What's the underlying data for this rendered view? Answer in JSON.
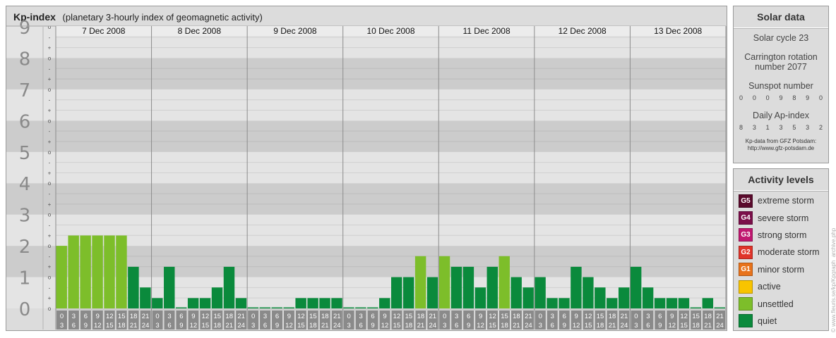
{
  "header": {
    "title": "Kp-index",
    "subtitle": "(planetary 3-hourly index of geomagnetic activity)"
  },
  "chart_data": {
    "type": "bar",
    "ylim": [
      0,
      9
    ],
    "y_ticks": [
      "0",
      "1",
      "2",
      "3",
      "4",
      "5",
      "6",
      "7",
      "8",
      "9"
    ],
    "minor_ticks": [
      "o",
      "+",
      "-"
    ],
    "days": [
      "7 Dec 2008",
      "8 Dec 2008",
      "9 Dec 2008",
      "10 Dec 2008",
      "11 Dec 2008",
      "12 Dec 2008",
      "13 Dec 2008"
    ],
    "interval_start": [
      "0",
      "3",
      "6",
      "9",
      "12",
      "15",
      "18",
      "21"
    ],
    "interval_end": [
      "3",
      "6",
      "9",
      "12",
      "15",
      "18",
      "21",
      "24"
    ],
    "values": [
      [
        2.0,
        2.33,
        2.33,
        2.33,
        2.33,
        2.33,
        1.33,
        0.67
      ],
      [
        0.33,
        1.33,
        0.0,
        0.33,
        0.33,
        0.67,
        1.33,
        0.33
      ],
      [
        0.0,
        0.0,
        0.0,
        0.0,
        0.33,
        0.33,
        0.33,
        0.33
      ],
      [
        0.0,
        0.0,
        0.0,
        0.33,
        1.0,
        1.0,
        1.67,
        1.0
      ],
      [
        1.67,
        1.33,
        1.33,
        0.67,
        1.33,
        1.67,
        1.0,
        0.67
      ],
      [
        1.0,
        0.33,
        0.33,
        1.33,
        1.0,
        0.67,
        0.33,
        0.67
      ],
      [
        1.33,
        0.67,
        0.33,
        0.33,
        0.33,
        0.0,
        0.33,
        0.0
      ]
    ],
    "colors": {
      "quiet": "#0a8a3c",
      "unsettled": "#7dbe2a"
    },
    "legend_position": "right"
  },
  "solar": {
    "heading": "Solar data",
    "cycle": "Solar cycle 23",
    "carrington_1": "Carrington rotation",
    "carrington_2": "number 2077",
    "sunspot_label": "Sunspot number",
    "sunspot": [
      "0",
      "0",
      "0",
      "9",
      "8",
      "9",
      "0"
    ],
    "ap_label": "Daily Ap-index",
    "ap": [
      "8",
      "3",
      "1",
      "3",
      "5",
      "3",
      "2"
    ],
    "credit_1": "Kp-data from GFZ Potsdam:",
    "credit_2": "http://www.gfz-potsdam.de"
  },
  "activity": {
    "heading": "Activity levels",
    "levels": [
      {
        "code": "G5",
        "label": "extreme storm",
        "color": "#5a0a2c"
      },
      {
        "code": "G4",
        "label": "severe storm",
        "color": "#7b0f4a"
      },
      {
        "code": "G3",
        "label": "strong storm",
        "color": "#c01870"
      },
      {
        "code": "G2",
        "label": "moderate storm",
        "color": "#e0342a"
      },
      {
        "code": "G1",
        "label": "minor storm",
        "color": "#e8731c"
      },
      {
        "code": "",
        "label": "active",
        "color": "#f8c400"
      },
      {
        "code": "",
        "label": "unsettled",
        "color": "#7dbe2a"
      },
      {
        "code": "",
        "label": "quiet",
        "color": "#0a8a3c"
      }
    ]
  },
  "watermark": "© www.fleuris.se/kp/Kpgraph_archive.php"
}
